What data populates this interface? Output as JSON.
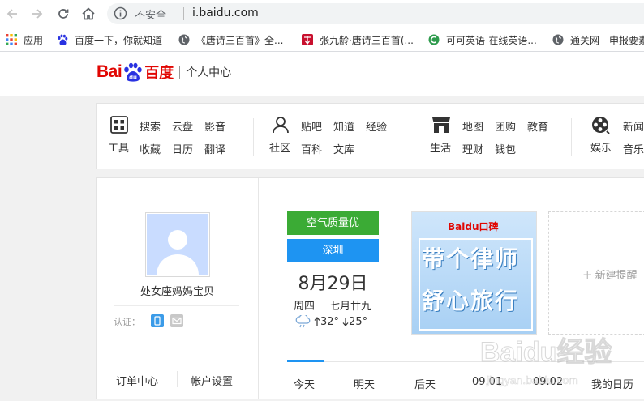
{
  "browser": {
    "security_label": "不安全",
    "url": "i.baidu.com"
  },
  "bookmarks": [
    {
      "label": "应用"
    },
    {
      "label": "百度一下，你就知道"
    },
    {
      "label": "《唐诗三百首》全..."
    },
    {
      "label": "张九龄·唐诗三百首(..."
    },
    {
      "label": "可可英语-在线英语..."
    },
    {
      "label": "通关网 - 申报要素"
    }
  ],
  "header": {
    "logo_bai": "Bai",
    "logo_du": "du",
    "logo_cn": "百度",
    "title": "个人中心"
  },
  "services": {
    "groups": [
      {
        "label": "工具",
        "icon": "grid-icon",
        "links": [
          "搜索",
          "云盘",
          "影音",
          "收藏",
          "日历",
          "翻译"
        ]
      },
      {
        "label": "社区",
        "icon": "person-icon",
        "links": [
          "贴吧",
          "知道",
          "经验",
          "百科",
          "文库"
        ]
      },
      {
        "label": "生活",
        "icon": "shop-icon",
        "links": [
          "地图",
          "团购",
          "教育",
          "理财",
          "钱包"
        ]
      },
      {
        "label": "娱乐",
        "icon": "film-reel-icon",
        "links": [
          "新闻",
          "音乐"
        ]
      }
    ]
  },
  "profile": {
    "username": "处女座妈妈宝贝",
    "verify_label": "认证：",
    "orders_label": "订单中心",
    "account_label": "帐户设置"
  },
  "weather": {
    "air_quality": "空气质量优",
    "city": "深圳",
    "date": "8月29日",
    "weekday": "周四",
    "lunar": "七月廿九",
    "high": "32°",
    "low": "25°"
  },
  "ad": {
    "logo": "Baidu口碑",
    "line1": "带个律师",
    "line2": "舒心旅行"
  },
  "reminder": {
    "label": "新建提醒"
  },
  "day_tabs": [
    "今天",
    "明天",
    "后天",
    "09.01",
    "09.02",
    "我的日历"
  ],
  "watermark": {
    "brand": "Baidu经验",
    "url": "jingyan.baidu.com"
  },
  "colors": {
    "baidu_red": "#e10602",
    "baidu_blue": "#2932e1",
    "air_green": "#3bab35",
    "city_blue": "#1e94f2"
  }
}
